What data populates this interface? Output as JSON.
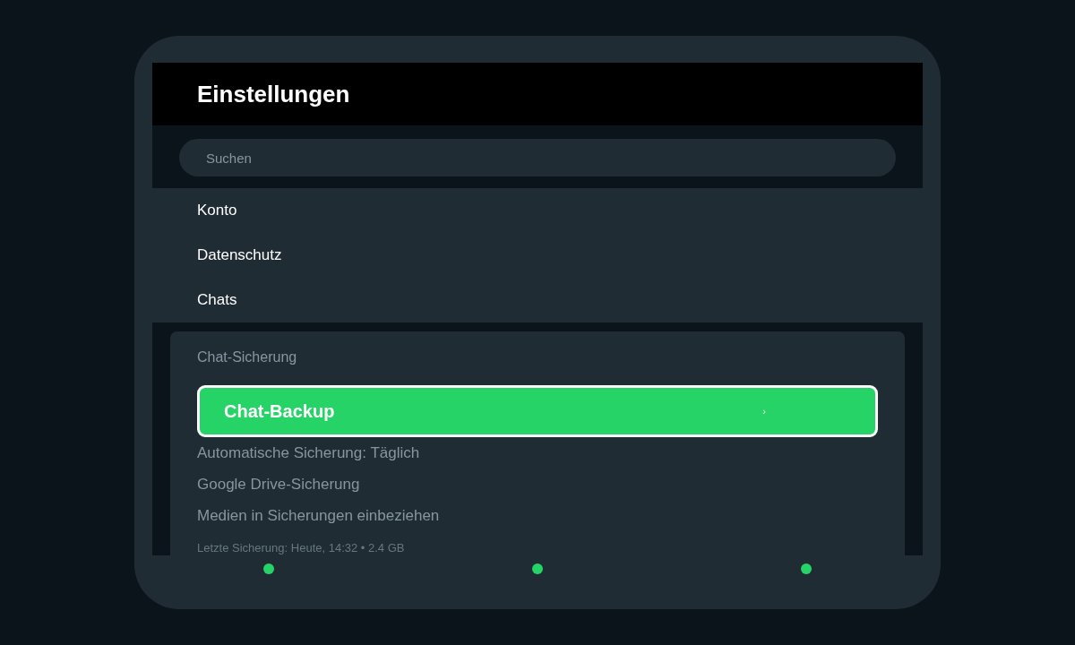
{
  "header": {
    "title": "Einstellungen"
  },
  "search": {
    "placeholder": "Suchen"
  },
  "menu": [
    {
      "label": "Konto"
    },
    {
      "label": "Datenschutz"
    },
    {
      "label": "Chats"
    }
  ],
  "section": {
    "title": "Chat-Sicherung",
    "primary": {
      "label": "Chat-Backup",
      "chevron": "›"
    },
    "items": [
      {
        "label": "Automatische Sicherung: Täglich"
      },
      {
        "label": "Google Drive-Sicherung"
      },
      {
        "label": "Medien in Sicherungen einbeziehen"
      }
    ],
    "footnote": "Letzte Sicherung: Heute, 14:32 • 2.4 GB"
  }
}
